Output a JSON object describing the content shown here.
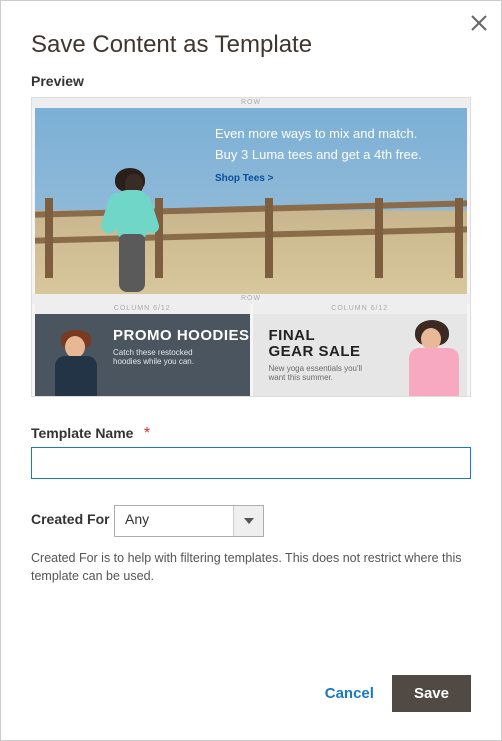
{
  "modal": {
    "title": "Save Content as Template",
    "close_icon": "close"
  },
  "preview": {
    "label": "Preview",
    "row_label": "ROW",
    "banner1": {
      "line1": "Even more ways to mix and match.",
      "line2": "Buy 3 Luma tees and get a 4th free.",
      "link": "Shop Tees >"
    },
    "row2": {
      "colA": {
        "col_label": "COLUMN 6/12",
        "title": "PROMO HOODIES",
        "sub": "Catch these restocked hoodies while you can."
      },
      "colB": {
        "col_label": "COLUMN 6/12",
        "title_line1": "FINAL",
        "title_line2": "GEAR SALE",
        "sub": "New yoga essentials you'll want this summer."
      }
    }
  },
  "form": {
    "template_name": {
      "label": "Template Name",
      "required_mark": "*",
      "value": ""
    },
    "created_for": {
      "label": "Created For",
      "selected": "Any",
      "helper": "Created For is to help with filtering templates. This does not restrict where this template can be used."
    }
  },
  "footer": {
    "cancel": "Cancel",
    "save": "Save"
  }
}
